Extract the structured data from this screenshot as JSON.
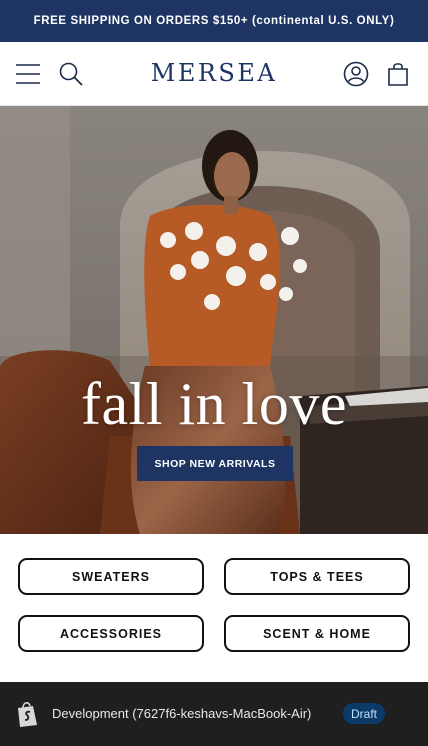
{
  "announcement": {
    "text": "FREE SHIPPING ON ORDERS $150+ (continental U.S. ONLY)"
  },
  "header": {
    "logo": "MERSEA",
    "icons": {
      "menu": "menu-icon",
      "search": "search-icon",
      "account": "account-icon",
      "cart": "cart-icon"
    }
  },
  "hero": {
    "heading": "fall in love",
    "cta_label": "SHOP NEW ARRIVALS"
  },
  "categories": {
    "items": [
      {
        "label": "SWEATERS"
      },
      {
        "label": "TOPS & TEES"
      },
      {
        "label": "ACCESSORIES"
      },
      {
        "label": "SCENT & HOME"
      }
    ]
  },
  "dev_bar": {
    "text": "Development (7627f6-keshavs-MacBook-Air)",
    "badge": "Draft",
    "icon": "shopify-bag-icon"
  },
  "colors": {
    "brand_navy": "#1e3563",
    "dev_bar_bg": "#1f1f1f",
    "badge_bg": "#0b3a66"
  }
}
